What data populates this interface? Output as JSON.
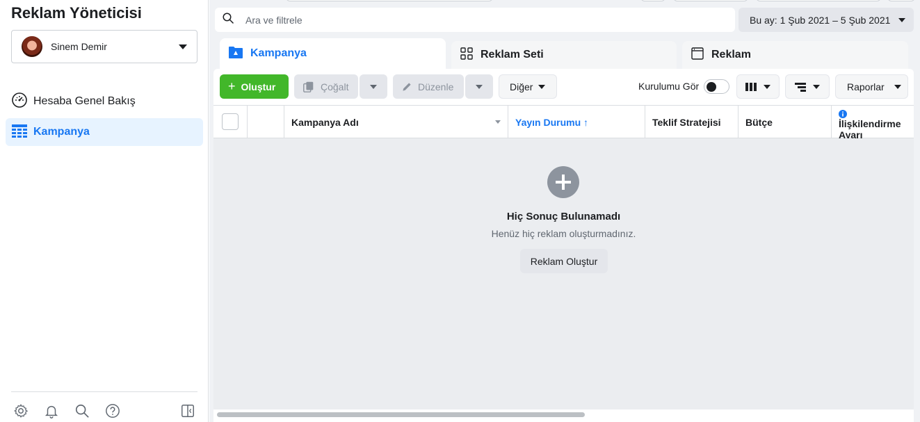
{
  "app": {
    "title": "Reklam Yöneticisi"
  },
  "account": {
    "name": "Sinem Demir"
  },
  "sidebar": {
    "items": [
      {
        "label": "Hesaba Genel Bakış",
        "icon": "gauge-icon"
      },
      {
        "label": "Kampanya",
        "icon": "table-grid-icon",
        "active": true
      }
    ],
    "footer_icons": [
      "gear-icon",
      "bell-icon",
      "search-icon",
      "help-icon",
      "panel-toggle-icon"
    ]
  },
  "search": {
    "placeholder": "Ara ve filtrele"
  },
  "date_range": {
    "label": "Bu ay: 1 Şub 2021 – 5 Şub 2021"
  },
  "tabs": [
    {
      "label": "Kampanya",
      "active": true
    },
    {
      "label": "Reklam Seti"
    },
    {
      "label": "Reklam"
    }
  ],
  "toolbar": {
    "create_label": "Oluştur",
    "duplicate_label": "Çoğalt",
    "edit_label": "Düzenle",
    "more_label": "Diğer",
    "setup_label": "Kurulumu Gör",
    "reports_label": "Raporlar"
  },
  "table": {
    "columns": [
      "Kampanya Adı",
      "Yayın Durumu ↑",
      "Teklif Stratejisi",
      "Bütçe",
      "İlişkilendirme Ayarı"
    ],
    "sorted_column": "Yayın Durumu"
  },
  "empty_state": {
    "title": "Hiç Sonuç Bulunamadı",
    "subtitle": "Henüz hiç reklam oluşturmadınız.",
    "button_label": "Reklam Oluştur"
  },
  "colors": {
    "accent": "#1877f2",
    "create_green": "#42b72a",
    "active_nav_bg": "#e7f3ff"
  }
}
